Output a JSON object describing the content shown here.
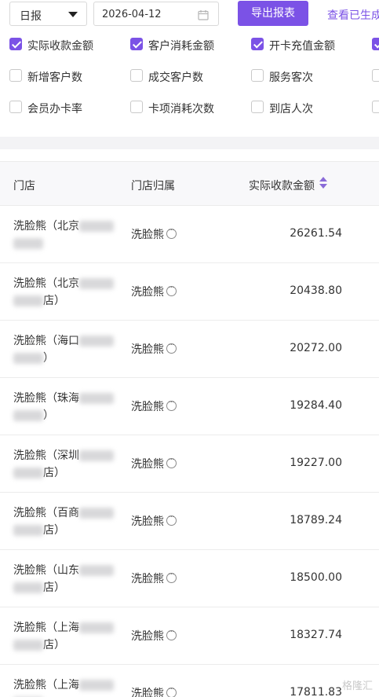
{
  "toolbar": {
    "period_value": "日报",
    "date_value": "2026-04-12",
    "export_label": "导出报表",
    "view_link_label": "查看已生成"
  },
  "filters": [
    [
      {
        "label": "实际收款金额",
        "checked": true
      },
      {
        "label": "客户消耗金额",
        "checked": true
      },
      {
        "label": "开卡充值金额",
        "checked": true
      },
      {
        "label": "",
        "checked": true
      }
    ],
    [
      {
        "label": "新增客户数",
        "checked": false
      },
      {
        "label": "成交客户数",
        "checked": false
      },
      {
        "label": "服务客次",
        "checked": false
      },
      {
        "label": "",
        "checked": false
      }
    ],
    [
      {
        "label": "会员办卡率",
        "checked": false
      },
      {
        "label": "卡项消耗次数",
        "checked": false
      },
      {
        "label": "到店人次",
        "checked": false
      },
      {
        "label": "",
        "checked": false
      }
    ]
  ],
  "table": {
    "headers": {
      "store": "门店",
      "brand": "门店归属",
      "amount": "实际收款金额"
    },
    "rows": [
      {
        "store_prefix": "洗脸熊（北京",
        "store_suffix": "",
        "brand": "洗脸熊",
        "amount": "26261.54"
      },
      {
        "store_prefix": "洗脸熊（北京",
        "store_suffix": "店）",
        "brand": "洗脸熊",
        "amount": "20438.80"
      },
      {
        "store_prefix": "洗脸熊（海口",
        "store_suffix": "）",
        "brand": "洗脸熊",
        "amount": "20272.00"
      },
      {
        "store_prefix": "洗脸熊（珠海",
        "store_suffix": "）",
        "brand": "洗脸熊",
        "amount": "19284.40"
      },
      {
        "store_prefix": "洗脸熊（深圳",
        "store_suffix": "店）",
        "brand": "洗脸熊",
        "amount": "19227.00"
      },
      {
        "store_prefix": "洗脸熊（百商",
        "store_suffix": "店）",
        "brand": "洗脸熊",
        "amount": "18789.24"
      },
      {
        "store_prefix": "洗脸熊（山东",
        "store_suffix": "店）",
        "brand": "洗脸熊",
        "amount": "18500.00"
      },
      {
        "store_prefix": "洗脸熊（上海",
        "store_suffix": "店）",
        "brand": "洗脸熊",
        "amount": "18327.74"
      },
      {
        "store_prefix": "洗脸熊（上海",
        "store_suffix": "",
        "brand": "洗脸熊",
        "amount": "17811.83"
      }
    ]
  },
  "watermark": "格隆汇",
  "colors": {
    "accent": "#7b52e6",
    "header_bg": "#f8f8fa",
    "band_bg": "#f3f3f5"
  }
}
